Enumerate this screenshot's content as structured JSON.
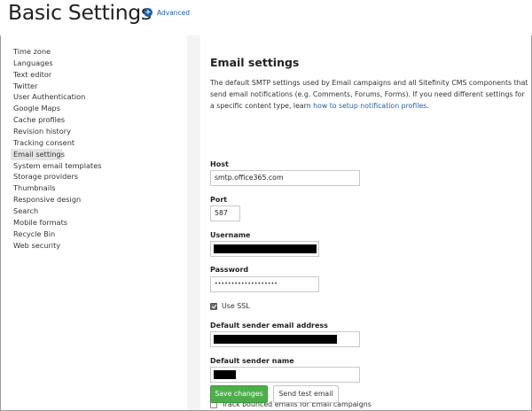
{
  "header": {
    "title": "Basic Settings",
    "advanced_label": "Advanced",
    "advanced_icon": "plus-circle-icon"
  },
  "sidebar": {
    "items": [
      {
        "label": "Time zone"
      },
      {
        "label": "Languages"
      },
      {
        "label": "Text editor"
      },
      {
        "label": "Twitter"
      },
      {
        "label": "User Authentication"
      },
      {
        "label": "Google Maps"
      },
      {
        "label": "Cache profiles"
      },
      {
        "label": "Revision history"
      },
      {
        "label": "Tracking consent"
      },
      {
        "label": "Email settings",
        "active": true
      },
      {
        "label": "System email templates"
      },
      {
        "label": "Storage providers"
      },
      {
        "label": "Thumbnails"
      },
      {
        "label": "Responsive design"
      },
      {
        "label": "Search"
      },
      {
        "label": "Mobile formats"
      },
      {
        "label": "Recycle Bin"
      },
      {
        "label": "Web security"
      }
    ]
  },
  "email": {
    "title": "Email settings",
    "description_prefix": "The default SMTP settings used by Email campaigns and all Sitefinity CMS components that send email notifications (e.g. Comments, Forums, Forms). If you need different settings for a specific content type, learn ",
    "description_link": "how to setup notification profiles",
    "description_suffix": ".",
    "host_label": "Host",
    "host_value": "smtp.office365.com",
    "port_label": "Port",
    "port_value": "587",
    "username_label": "Username",
    "password_label": "Password",
    "password_value": "•••••••••••••••••••",
    "ssl_label": "Use SSL",
    "ssl_checked": true,
    "sender_address_label": "Default sender email address",
    "sender_name_label": "Default sender name",
    "bounce_label": "Track bounced emails for Email campaigns",
    "bounce_checked": false,
    "save_label": "Save changes",
    "test_label": "Send test email"
  },
  "colors": {
    "accent_green": "#4fae4c",
    "link_blue": "#1f5fa8"
  }
}
